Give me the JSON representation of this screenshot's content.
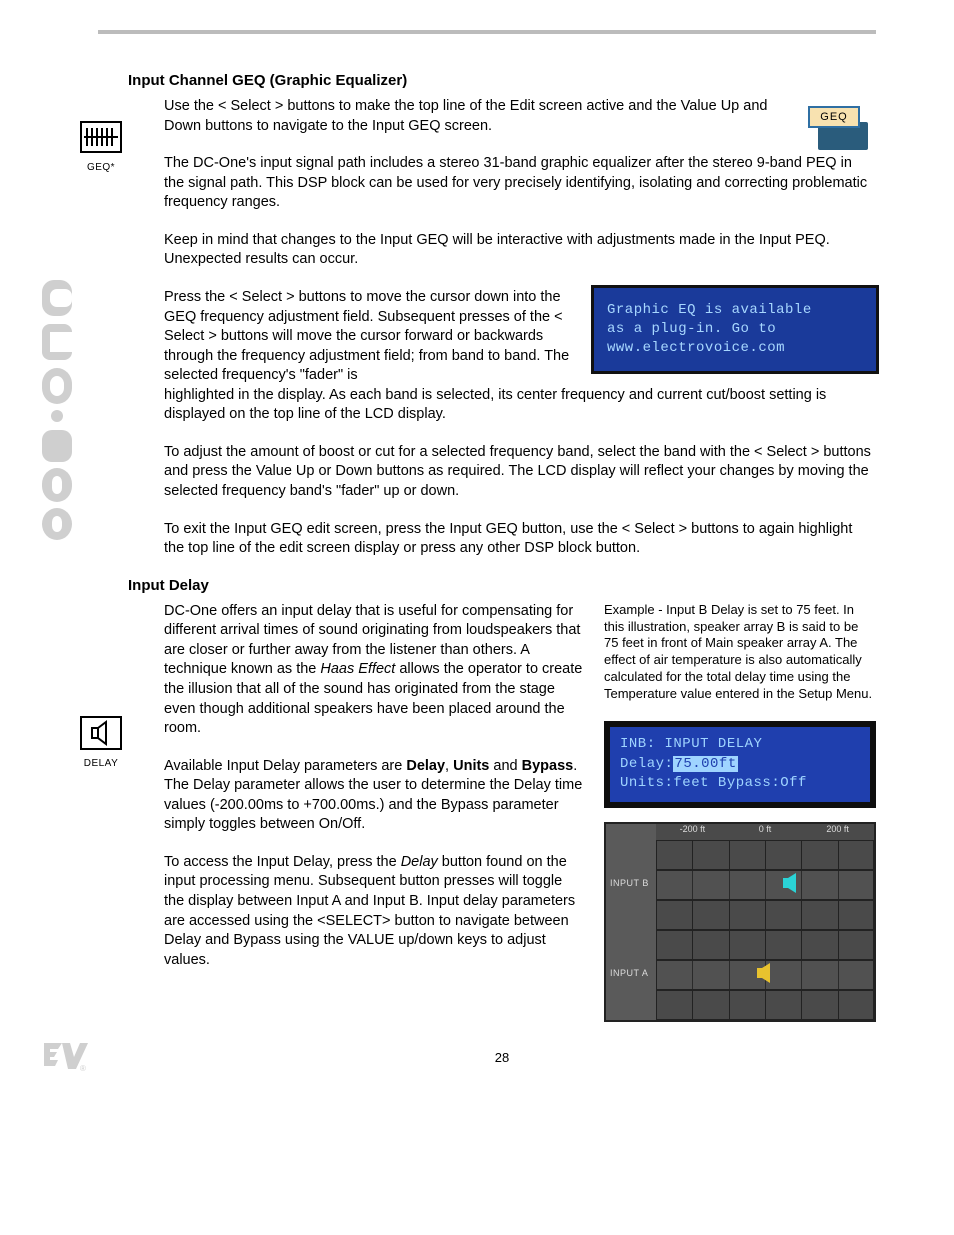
{
  "geq_section": {
    "heading": "Input Channel GEQ (Graphic Equalizer)",
    "p1": "Use the < Select > buttons to make the top line of the Edit screen active and the Value Up and Down buttons to navigate to the Input GEQ screen.",
    "p2": "The DC-One's input signal path includes a stereo 31-band graphic equalizer after the stereo 9-band PEQ in the signal path. This DSP block can be used for very precisely identifying, isolating and correcting problematic frequency ranges.",
    "p3": "Keep in mind that changes to the Input GEQ will be interactive with adjustments made in the Input PEQ. Unexpected results can occur.",
    "p4a": "Press the < Select > buttons to move the cursor down into the GEQ frequency adjustment field. Subsequent presses of the < Select > buttons will move the cursor forward or backwards through the frequency adjustment field; from band to band. The selected frequency's \"fader\" is",
    "p4b": "highlighted in the display. As each band is selected, its center frequency and current cut/boost setting is displayed on the top line of the LCD display.",
    "p5": "To adjust the amount of boost or cut for a selected frequency band, select the band with the < Select > buttons and press the Value Up or Down buttons as required. The LCD display will reflect your changes by moving the selected frequency band's \"fader\" up or down.",
    "p6": "To exit the Input GEQ edit screen, press the Input GEQ button, use the < Select > buttons to again highlight the top line of the edit screen display or press any other DSP block button.",
    "badge": "GEQ",
    "left_cap": "GEQ*",
    "lcd_l1": "Graphic EQ is available",
    "lcd_l2": "as a plug-in. Go to",
    "lcd_l3": "www.electrovoice.com"
  },
  "delay_section": {
    "heading": "Input Delay",
    "left_cap": "DELAY",
    "p1_a": "DC-One offers an input delay that is useful for compensating for different arrival times of sound originating from loudspeakers that are closer or further away from the listener than others. A technique known as the ",
    "p1_em": "Haas Effect",
    "p1_b": " allows the operator to create the illusion that all of the sound has originated from the stage even though additional speakers have been placed around the room.",
    "p2_a": "Available Input Delay parameters are ",
    "p2_b1": "Delay",
    "p2_b2": "Units",
    "p2_b3": "Bypass",
    "p2_c": ". The Delay parameter allows the user to determine the Delay time values (-200.00ms to +700.00ms.) and the Bypass parameter simply toggles between On/Off.",
    "p3_a": "To access the Input Delay, press the ",
    "p3_em": "Delay",
    "p3_b": " button found on the input processing menu. Subsequent button presses will toggle the display between Input A and Input B. Input delay parameters are accessed using the <SELECT> button to navigate between Delay and Bypass using the VALUE up/down keys to adjust values.",
    "example": "Example - Input B Delay is set to 75 feet. In this illustration, speaker array B is said to be 75 feet in front of Main speaker array A. The effect of air temperature is also automatically calculated for the total delay time using the Temperature value entered in the Setup Menu.",
    "lcd_l1": "INB: INPUT DELAY",
    "lcd_l2a": "Delay:",
    "lcd_l2b": "75.00ft",
    "lcd_l3": "Units:feet  Bypass:Off",
    "grid": {
      "h1": "-200 ft",
      "h2": "0 ft",
      "h3": "200 ft",
      "rowB": "INPUT B",
      "rowA": "INPUT A"
    }
  },
  "page_number": "28"
}
